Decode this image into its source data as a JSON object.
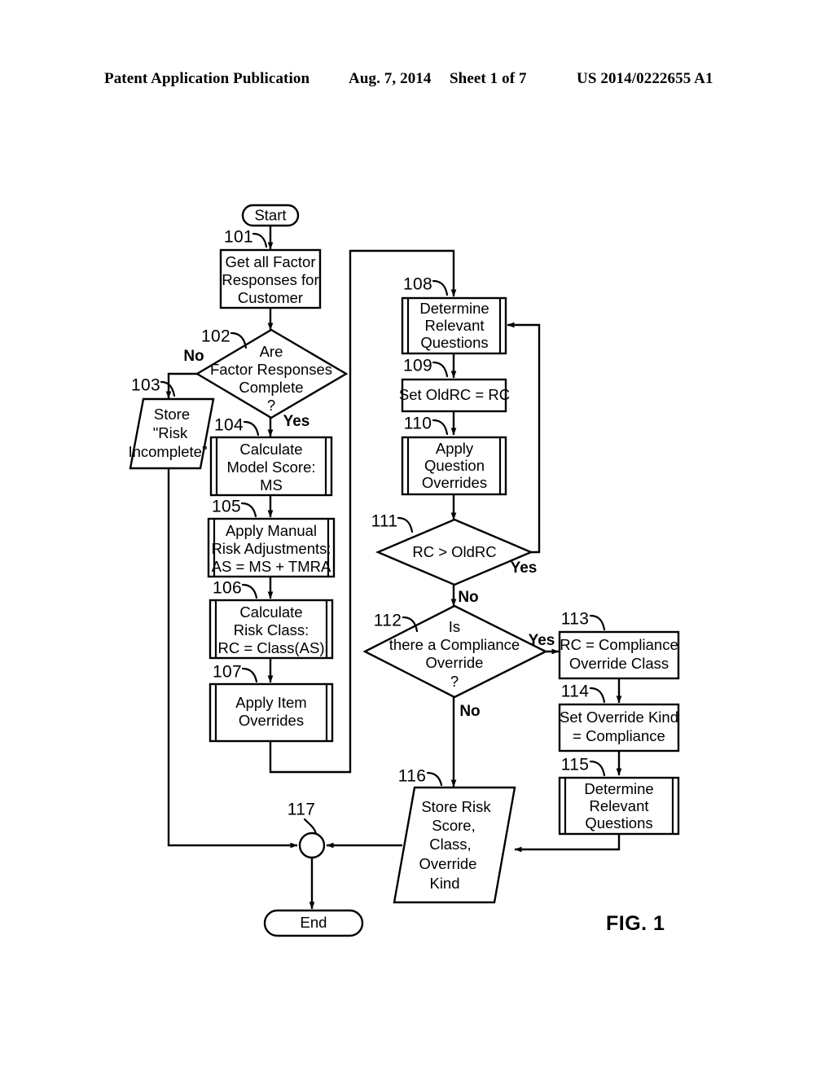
{
  "header": {
    "publication": "Patent Application Publication",
    "date": "Aug. 7, 2014",
    "sheet": "Sheet 1 of 7",
    "patent_number": "US 2014/0222655 A1"
  },
  "figure": {
    "label": "FIG. 1",
    "type": "flowchart",
    "terminators": {
      "start": "Start",
      "end": "End"
    },
    "branch_labels": {
      "no_102": "No",
      "yes_102": "Yes",
      "yes_111": "Yes",
      "no_111": "No",
      "yes_112": "Yes",
      "no_112": "No"
    },
    "nodes": [
      {
        "ref": "101",
        "shape": "process",
        "lines": [
          "Get all Factor",
          "Responses for",
          "Customer"
        ]
      },
      {
        "ref": "102",
        "shape": "decision",
        "lines": [
          "Are",
          "Factor Responses",
          "Complete",
          "?"
        ]
      },
      {
        "ref": "103",
        "shape": "data",
        "lines": [
          "Store",
          "\"Risk",
          "Incomplete\""
        ]
      },
      {
        "ref": "104",
        "shape": "subroutine",
        "lines": [
          "Calculate",
          "Model Score:",
          "MS"
        ]
      },
      {
        "ref": "105",
        "shape": "subroutine",
        "lines": [
          "Apply Manual",
          "Risk Adjustments:",
          "AS = MS + TMRA"
        ]
      },
      {
        "ref": "106",
        "shape": "subroutine",
        "lines": [
          "Calculate",
          "Risk Class:",
          "RC = Class(AS)"
        ]
      },
      {
        "ref": "107",
        "shape": "subroutine",
        "lines": [
          "Apply Item",
          "Overrides"
        ]
      },
      {
        "ref": "108",
        "shape": "subroutine",
        "lines": [
          "Determine",
          "Relevant",
          "Questions"
        ]
      },
      {
        "ref": "109",
        "shape": "process",
        "lines": [
          "Set OldRC = RC"
        ]
      },
      {
        "ref": "110",
        "shape": "subroutine",
        "lines": [
          "Apply",
          "Question",
          "Overrides"
        ]
      },
      {
        "ref": "111",
        "shape": "decision",
        "lines": [
          "RC > OldRC"
        ]
      },
      {
        "ref": "112",
        "shape": "decision",
        "lines": [
          "Is",
          "there a Compliance",
          "Override",
          "?"
        ]
      },
      {
        "ref": "113",
        "shape": "process",
        "lines": [
          "RC = Compliance",
          "Override Class"
        ]
      },
      {
        "ref": "114",
        "shape": "process",
        "lines": [
          "Set Override Kind",
          "= Compliance"
        ]
      },
      {
        "ref": "115",
        "shape": "subroutine",
        "lines": [
          "Determine",
          "Relevant",
          "Questions"
        ]
      },
      {
        "ref": "116",
        "shape": "data",
        "lines": [
          "Store Risk",
          "Score,",
          "Class,",
          "Override",
          "Kind"
        ]
      },
      {
        "ref": "117",
        "shape": "connector",
        "lines": []
      }
    ]
  }
}
